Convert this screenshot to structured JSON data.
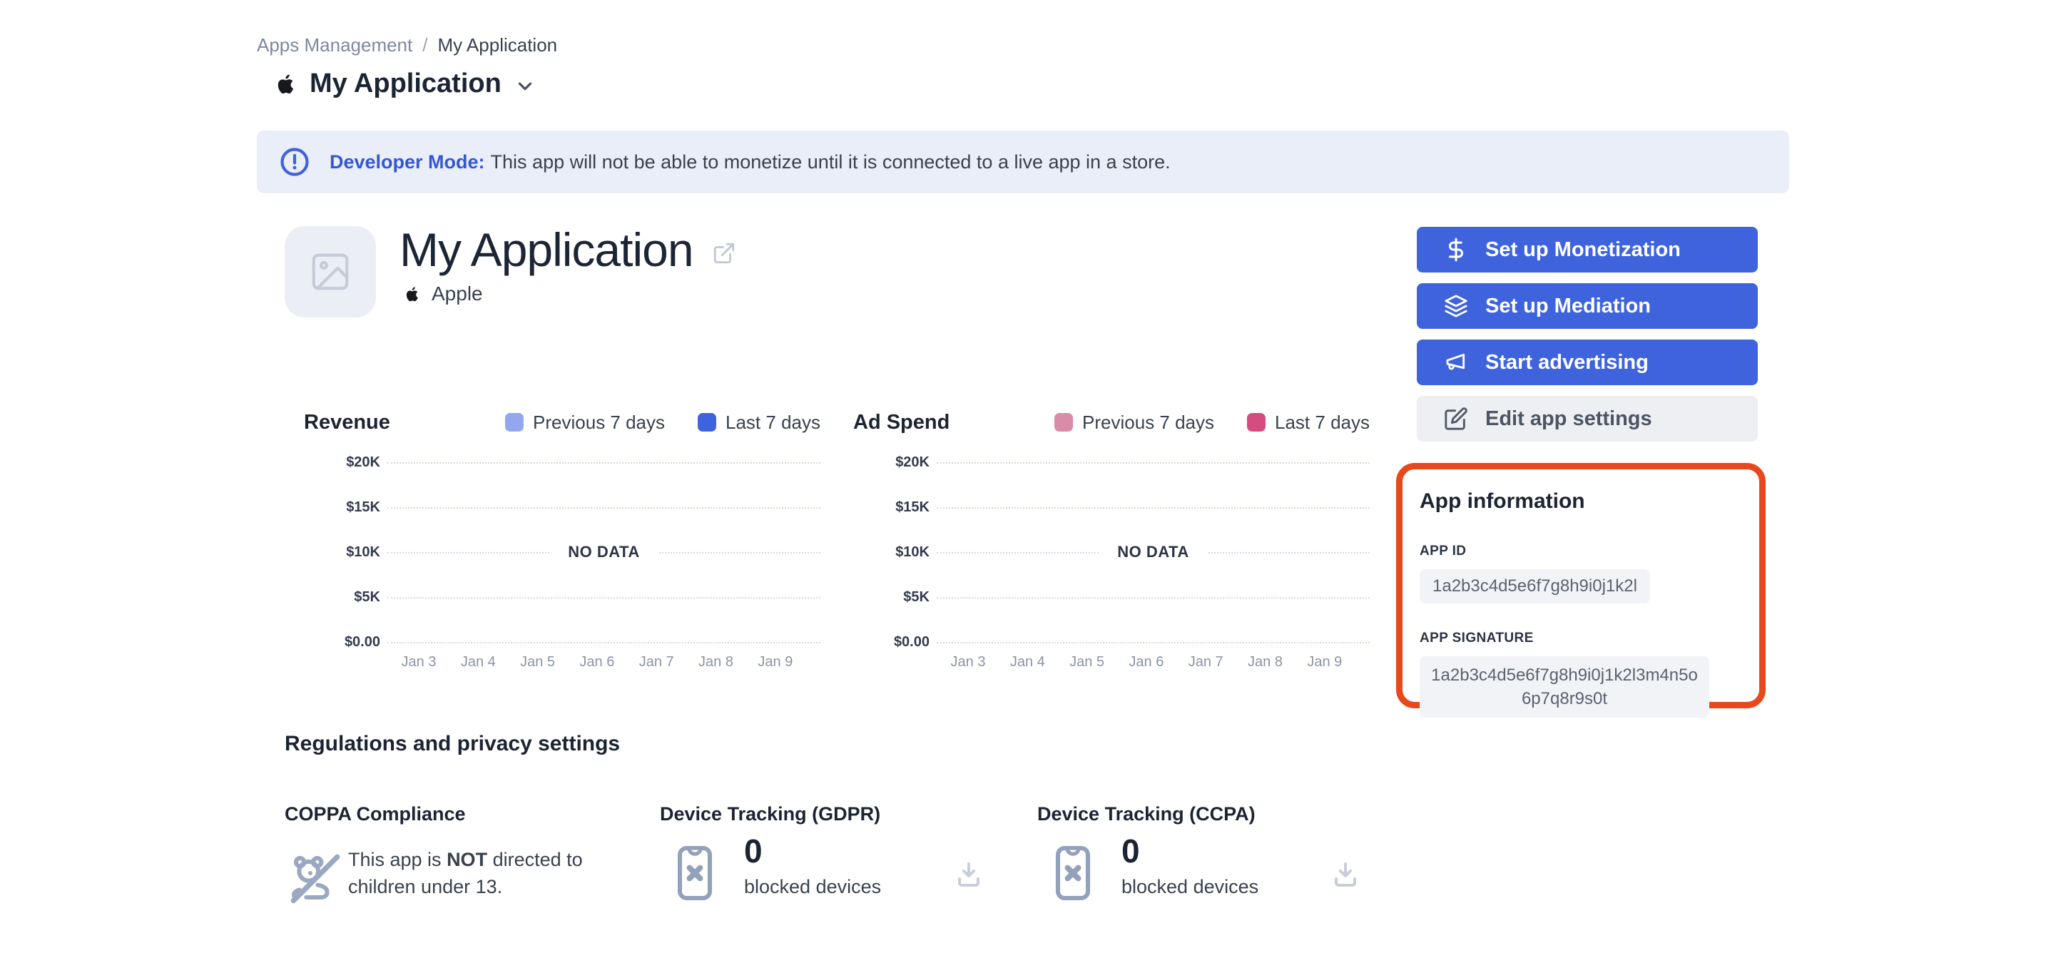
{
  "colors": {
    "accent_blue": "#3e63dd",
    "banner_bg": "#eaeef9",
    "highlight_orange": "#e8481c",
    "revenue_prev": "#93a8ec",
    "revenue_last": "#3e63dd",
    "adspend_prev": "#d88ca8",
    "adspend_last": "#d54c80"
  },
  "breadcrumb": {
    "parent": "Apps Management",
    "separator": "/",
    "current": "My Application"
  },
  "page_title": "My Application",
  "banner": {
    "title": "Developer Mode:",
    "message": "This app will not be able to monetize until it is connected to a live app in a store."
  },
  "app_header": {
    "name": "My Application",
    "platform": "Apple"
  },
  "actions": {
    "monetization": "Set up Monetization",
    "mediation": "Set up Mediation",
    "advertising": "Start advertising",
    "edit": "Edit app settings"
  },
  "chart_data": [
    {
      "type": "line",
      "title": "Revenue",
      "categories": [
        "Jan 3",
        "Jan 4",
        "Jan 5",
        "Jan 6",
        "Jan 7",
        "Jan 8",
        "Jan 9"
      ],
      "series": [
        {
          "name": "Previous 7 days",
          "color": "#93a8ec",
          "values": []
        },
        {
          "name": "Last 7 days",
          "color": "#3e63dd",
          "values": []
        }
      ],
      "yticks": [
        "$20K",
        "$15K",
        "$10K",
        "$5K",
        "$0.00"
      ],
      "ylim": [
        0,
        20000
      ],
      "empty_label": "NO DATA",
      "grid": "horizontal-dotted",
      "legend_position": "top-right"
    },
    {
      "type": "line",
      "title": "Ad Spend",
      "categories": [
        "Jan 3",
        "Jan 4",
        "Jan 5",
        "Jan 6",
        "Jan 7",
        "Jan 8",
        "Jan 9"
      ],
      "series": [
        {
          "name": "Previous 7 days",
          "color": "#d88ca8",
          "values": []
        },
        {
          "name": "Last 7 days",
          "color": "#d54c80",
          "values": []
        }
      ],
      "yticks": [
        "$20K",
        "$15K",
        "$10K",
        "$5K",
        "$0.00"
      ],
      "ylim": [
        0,
        20000
      ],
      "empty_label": "NO DATA",
      "grid": "horizontal-dotted",
      "legend_position": "top-right"
    }
  ],
  "app_information": {
    "title": "App information",
    "fields": [
      {
        "label": "APP ID",
        "value": "1a2b3c4d5e6f7g8h9i0j1k2l"
      },
      {
        "label": "APP SIGNATURE",
        "value": "1a2b3c4d5e6f7g8h9i0j1k2l3m4n5o6p7q8r9s0t"
      }
    ]
  },
  "regulations": {
    "title": "Regulations and privacy settings",
    "coppa": {
      "title": "COPPA Compliance",
      "text_prefix": "This app is ",
      "text_bold": "NOT",
      "text_suffix": " directed to children under 13."
    },
    "gdpr": {
      "title": "Device Tracking (GDPR)",
      "count": "0",
      "label": "blocked devices"
    },
    "ccpa": {
      "title": "Device Tracking (CCPA)",
      "count": "0",
      "label": "blocked devices"
    }
  }
}
